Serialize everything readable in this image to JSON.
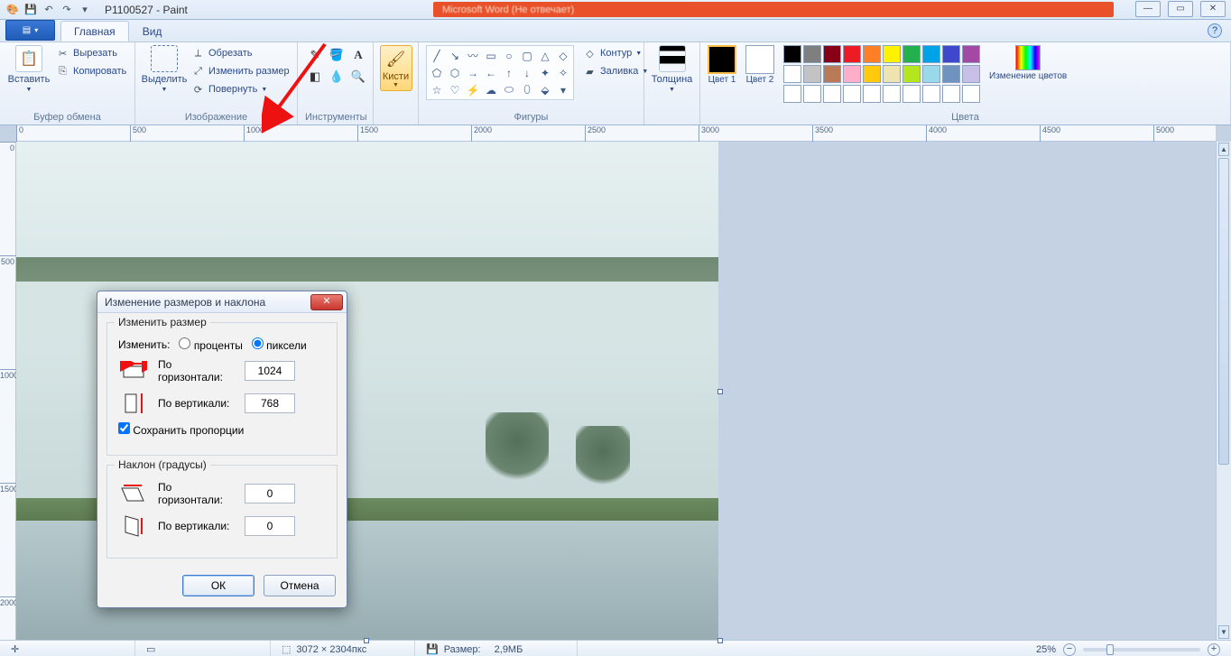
{
  "titlebar": {
    "document": "P1100527",
    "app": "Paint",
    "bg_task": "Microsoft Word (Не отвечает)"
  },
  "window_buttons": {
    "min": "—",
    "max": "▭",
    "close": "✕"
  },
  "tabs": {
    "file_glyph": "▤",
    "home": "Главная",
    "view": "Вид"
  },
  "ribbon": {
    "clipboard": {
      "label": "Буфер обмена",
      "paste": "Вставить",
      "cut": "Вырезать",
      "copy": "Копировать"
    },
    "image": {
      "label": "Изображение",
      "select": "Выделить",
      "crop": "Обрезать",
      "resize": "Изменить размер",
      "rotate": "Повернуть"
    },
    "tools": {
      "label": "Инструменты"
    },
    "brushes": {
      "label": "Кисти"
    },
    "shapes": {
      "label": "Фигуры",
      "outline": "Контур",
      "fill": "Заливка"
    },
    "thickness": "Толщина",
    "color1": "Цвет 1",
    "color2": "Цвет 2",
    "colors_label": "Цвета",
    "edit_colors": "Изменение цветов"
  },
  "palette_row1": [
    "#000000",
    "#7f7f7f",
    "#880015",
    "#ed1c24",
    "#ff7f27",
    "#fff200",
    "#22b14c",
    "#00a2e8",
    "#3f48cc",
    "#a349a4"
  ],
  "palette_row2": [
    "#ffffff",
    "#c3c3c3",
    "#b97a57",
    "#ffaec9",
    "#ffc90e",
    "#efe4b0",
    "#b5e61d",
    "#99d9ea",
    "#7092be",
    "#c8bfe7"
  ],
  "palette_row3": [
    "#ffffff",
    "#ffffff",
    "#ffffff",
    "#ffffff",
    "#ffffff",
    "#ffffff",
    "#ffffff",
    "#ffffff",
    "#ffffff",
    "#ffffff"
  ],
  "ruler_h": [
    "0",
    "500",
    "1000",
    "1500",
    "2000",
    "2500",
    "3000",
    "3500",
    "4000",
    "4500",
    "5000"
  ],
  "ruler_v": [
    "0",
    "500",
    "1000",
    "1500",
    "2000"
  ],
  "dialog": {
    "title": "Изменение размеров и наклона",
    "resize_legend": "Изменить размер",
    "by_label": "Изменить:",
    "percent": "проценты",
    "pixels": "пиксели",
    "horiz": "По горизонтали:",
    "vert": "По вертикали:",
    "h_value": "1024",
    "v_value": "768",
    "aspect": "Сохранить пропорции",
    "skew_legend": "Наклон (градусы)",
    "skew_h": "0",
    "skew_v": "0",
    "ok": "ОК",
    "cancel": "Отмена"
  },
  "status": {
    "dims": "3072 × 2304пкс",
    "size_label": "Размер:",
    "size_val": "2,9МБ",
    "zoom": "25%"
  }
}
